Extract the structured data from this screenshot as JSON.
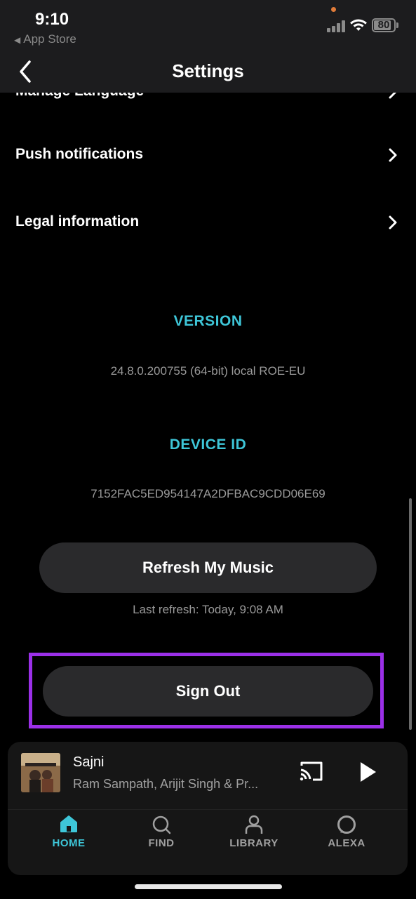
{
  "status_bar": {
    "time": "9:10",
    "back_app": "App Store",
    "battery": "80"
  },
  "header": {
    "title": "Settings"
  },
  "settings": {
    "items": [
      {
        "label": "Manage Language"
      },
      {
        "label": "Push notifications"
      },
      {
        "label": "Legal information"
      }
    ]
  },
  "version": {
    "heading": "VERSION",
    "value": "24.8.0.200755 (64-bit) local ROE-EU"
  },
  "device": {
    "heading": "DEVICE ID",
    "value": "7152FAC5ED954147A2DFBAC9CDD06E69"
  },
  "refresh": {
    "button_label": "Refresh My Music",
    "last_refresh": "Last refresh: Today, 9:08 AM"
  },
  "sign_out": {
    "button_label": "Sign Out"
  },
  "player": {
    "title": "Sajni",
    "artist": "Ram Sampath, Arijit Singh & Pr..."
  },
  "tabs": [
    {
      "label": "HOME",
      "icon": "home-icon",
      "active": true
    },
    {
      "label": "FIND",
      "icon": "search-icon",
      "active": false
    },
    {
      "label": "LIBRARY",
      "icon": "person-icon",
      "active": false
    },
    {
      "label": "ALEXA",
      "icon": "alexa-icon",
      "active": false
    }
  ],
  "colors": {
    "accent": "#3ec6d8",
    "highlight": "#9b30e8",
    "background": "#000000"
  }
}
